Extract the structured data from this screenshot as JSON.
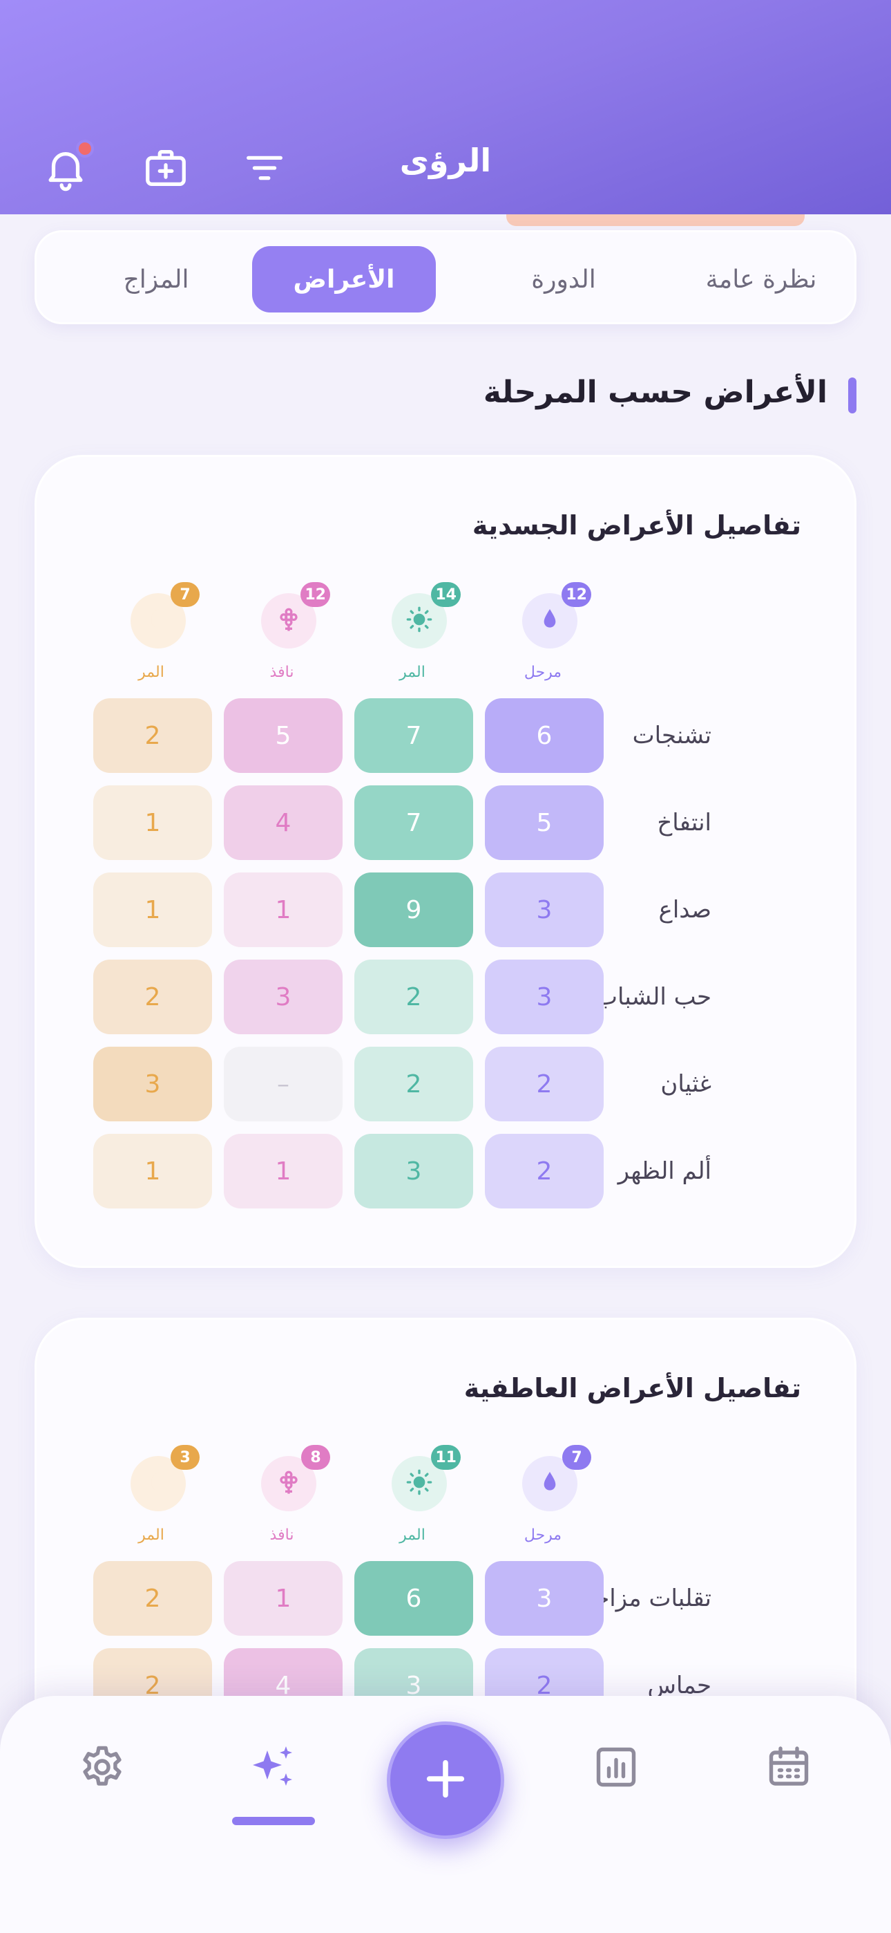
{
  "header": {
    "title": "الرؤى",
    "icons": [
      "bell-icon",
      "medical-kit-icon",
      "filter-icon"
    ],
    "colors": {
      "gradient_start": "#a18cf8",
      "gradient_end": "#7360d8",
      "notification_dot": "#f26b6b"
    }
  },
  "tabs": {
    "active": "الأعراض",
    "items": [
      "نظرة عامة",
      "الدورة",
      "الأعراض",
      "المزاج"
    ]
  },
  "section": {
    "title": "الأعراض حسب المرحلة"
  },
  "phases": [
    {
      "key": "menstrual",
      "icon": "drop-icon",
      "color": "#8e7af0"
    },
    {
      "key": "follicular",
      "icon": "sun-icon",
      "color": "#4fb7a3"
    },
    {
      "key": "ovulation",
      "icon": "flower-icon",
      "color": "#e07cc4"
    },
    {
      "key": "luteal",
      "icon": "moon-icon",
      "color": "#e8a84c"
    }
  ],
  "physical": {
    "title": "تفاصيل الأعراض الجسدية",
    "badges": [
      "12",
      "14",
      "12",
      "7"
    ],
    "labels": [
      "مرحل",
      "المر",
      "نافذ",
      "المر"
    ],
    "rows": [
      {
        "label": "تشنجات",
        "values": [
          "6",
          "7",
          "5",
          "2"
        ]
      },
      {
        "label": "انتفاخ",
        "values": [
          "5",
          "7",
          "4",
          "1"
        ]
      },
      {
        "label": "صداع",
        "values": [
          "3",
          "9",
          "1",
          "1"
        ]
      },
      {
        "label": "حب الشباب",
        "values": [
          "3",
          "2",
          "3",
          "2"
        ]
      },
      {
        "label": "غثيان",
        "values": [
          "2",
          "2",
          "–",
          "3"
        ]
      },
      {
        "label": "ألم الظهر",
        "values": [
          "2",
          "3",
          "1",
          "1"
        ]
      }
    ]
  },
  "emotional": {
    "title": "تفاصيل الأعراض العاطفية",
    "badges": [
      "7",
      "11",
      "8",
      "3"
    ],
    "labels": [
      "مرحل",
      "المر",
      "نافذ",
      "المر"
    ],
    "rows": [
      {
        "label": "تقلبات مزاجية",
        "values": [
          "3",
          "6",
          "1",
          "2"
        ]
      },
      {
        "label": "حماس",
        "values": [
          "2",
          "3",
          "4",
          "2"
        ]
      }
    ]
  },
  "bottom_nav": {
    "items": [
      "calendar-icon",
      "bar-chart-icon",
      "add-icon",
      "sparkles-icon",
      "gear-icon"
    ],
    "active": "sparkles-icon"
  }
}
